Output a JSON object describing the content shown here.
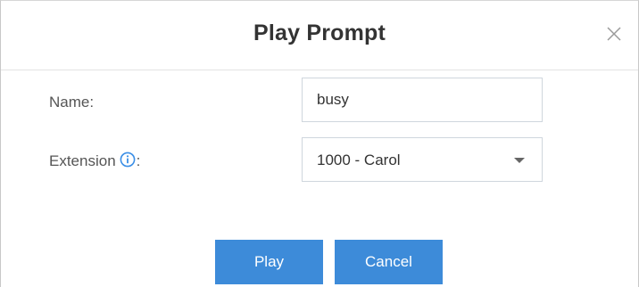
{
  "dialog": {
    "title": "Play Prompt",
    "close_icon": "close-icon"
  },
  "form": {
    "name_label": "Name:",
    "name_value": "busy",
    "extension_label": "Extension",
    "extension_suffix": ":",
    "extension_info_icon": "info-icon",
    "extension_value": "1000 - Carol"
  },
  "buttons": {
    "play_label": "Play",
    "cancel_label": "Cancel"
  },
  "colors": {
    "primary": "#3d8bd9",
    "info_icon": "#3a8ee6"
  }
}
